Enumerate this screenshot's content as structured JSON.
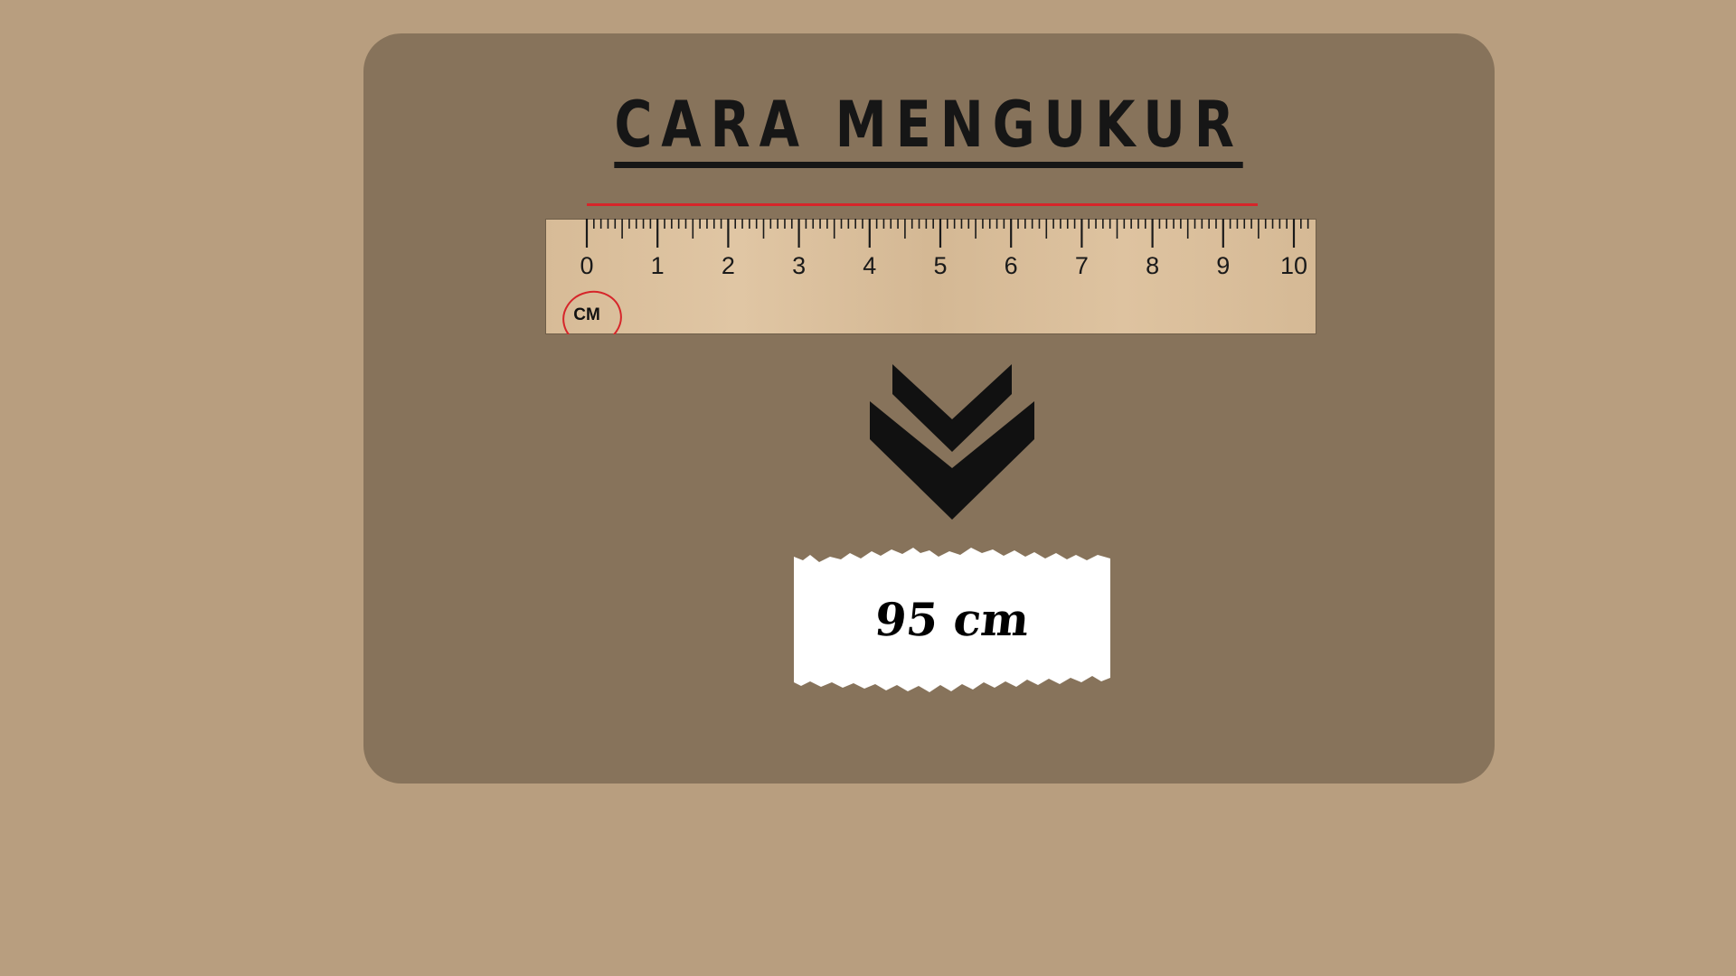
{
  "title": "CARA MENGUKUR",
  "ruler": {
    "unit_label": "CM",
    "numbers": [
      "0",
      "1",
      "2",
      "3",
      "4",
      "5",
      "6",
      "7",
      "8",
      "9",
      "10"
    ]
  },
  "arrow_icon": "double-chevron-down-icon",
  "result": {
    "value": "95 cm"
  },
  "colors": {
    "background": "#b89e7f",
    "card": "#87735b",
    "ruler_wood": "#dcc19e",
    "highlight": "#d6252a"
  }
}
